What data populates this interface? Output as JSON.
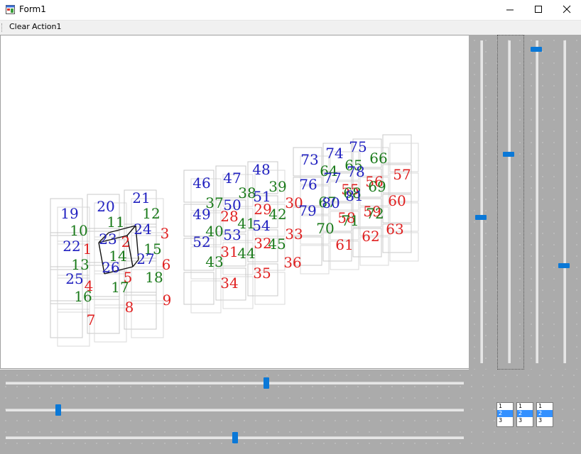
{
  "window": {
    "title": "Form1",
    "icon": "app-window-icon",
    "controls": {
      "minimize": "minimize-icon",
      "maximize": "maximize-icon",
      "close": "close-icon"
    }
  },
  "menu": {
    "items": [
      {
        "label": "Clear"
      },
      {
        "label": "Action1"
      }
    ]
  },
  "colors": {
    "red": "#e02020",
    "green": "#1a7a1a",
    "blue": "#2020c0",
    "accent": "#0a78d7",
    "panel": "#ababab"
  },
  "canvas": {
    "labels": [
      {
        "t": "1",
        "c": "red"
      },
      {
        "t": "2",
        "c": "red"
      },
      {
        "t": "3",
        "c": "red"
      },
      {
        "t": "4",
        "c": "red"
      },
      {
        "t": "5",
        "c": "red"
      },
      {
        "t": "6",
        "c": "red"
      },
      {
        "t": "7",
        "c": "red"
      },
      {
        "t": "8",
        "c": "red"
      },
      {
        "t": "9",
        "c": "red"
      },
      {
        "t": "10",
        "c": "green"
      },
      {
        "t": "11",
        "c": "green"
      },
      {
        "t": "12",
        "c": "green"
      },
      {
        "t": "13",
        "c": "green"
      },
      {
        "t": "14",
        "c": "green"
      },
      {
        "t": "15",
        "c": "green"
      },
      {
        "t": "16",
        "c": "green"
      },
      {
        "t": "17",
        "c": "green"
      },
      {
        "t": "18",
        "c": "green"
      },
      {
        "t": "19",
        "c": "blue"
      },
      {
        "t": "20",
        "c": "blue"
      },
      {
        "t": "21",
        "c": "blue"
      },
      {
        "t": "22",
        "c": "blue"
      },
      {
        "t": "23",
        "c": "blue"
      },
      {
        "t": "24",
        "c": "blue"
      },
      {
        "t": "25",
        "c": "blue"
      },
      {
        "t": "26",
        "c": "blue"
      },
      {
        "t": "27",
        "c": "blue"
      },
      {
        "t": "28",
        "c": "red"
      },
      {
        "t": "29",
        "c": "red"
      },
      {
        "t": "30",
        "c": "red"
      },
      {
        "t": "31",
        "c": "red"
      },
      {
        "t": "32",
        "c": "red"
      },
      {
        "t": "33",
        "c": "red"
      },
      {
        "t": "34",
        "c": "red"
      },
      {
        "t": "35",
        "c": "red"
      },
      {
        "t": "36",
        "c": "red"
      },
      {
        "t": "37",
        "c": "green"
      },
      {
        "t": "38",
        "c": "green"
      },
      {
        "t": "39",
        "c": "green"
      },
      {
        "t": "40",
        "c": "green"
      },
      {
        "t": "41",
        "c": "green"
      },
      {
        "t": "42",
        "c": "green"
      },
      {
        "t": "43",
        "c": "green"
      },
      {
        "t": "44",
        "c": "green"
      },
      {
        "t": "45",
        "c": "green"
      },
      {
        "t": "46",
        "c": "blue"
      },
      {
        "t": "47",
        "c": "blue"
      },
      {
        "t": "48",
        "c": "blue"
      },
      {
        "t": "49",
        "c": "blue"
      },
      {
        "t": "50",
        "c": "blue"
      },
      {
        "t": "51",
        "c": "blue"
      },
      {
        "t": "52",
        "c": "blue"
      },
      {
        "t": "53",
        "c": "blue"
      },
      {
        "t": "54",
        "c": "blue"
      },
      {
        "t": "55",
        "c": "red"
      },
      {
        "t": "56",
        "c": "red"
      },
      {
        "t": "57",
        "c": "red"
      },
      {
        "t": "58",
        "c": "red"
      },
      {
        "t": "59",
        "c": "red"
      },
      {
        "t": "60",
        "c": "red"
      },
      {
        "t": "61",
        "c": "red"
      },
      {
        "t": "62",
        "c": "red"
      },
      {
        "t": "63",
        "c": "red"
      },
      {
        "t": "64",
        "c": "green"
      },
      {
        "t": "65",
        "c": "green"
      },
      {
        "t": "66",
        "c": "green"
      },
      {
        "t": "67",
        "c": "green"
      },
      {
        "t": "68",
        "c": "green"
      },
      {
        "t": "69",
        "c": "green"
      },
      {
        "t": "70",
        "c": "green"
      },
      {
        "t": "71",
        "c": "green"
      },
      {
        "t": "72",
        "c": "green"
      },
      {
        "t": "73",
        "c": "blue"
      },
      {
        "t": "74",
        "c": "blue"
      },
      {
        "t": "75",
        "c": "blue"
      },
      {
        "t": "76",
        "c": "blue"
      },
      {
        "t": "77",
        "c": "blue"
      },
      {
        "t": "78",
        "c": "blue"
      },
      {
        "t": "79",
        "c": "blue"
      },
      {
        "t": "80",
        "c": "blue"
      },
      {
        "t": "81",
        "c": "blue"
      }
    ]
  },
  "sliders": {
    "vertical": [
      {
        "value": 0.55
      },
      {
        "value": 0.35
      },
      {
        "value": 0.02
      },
      {
        "value": 0.7
      }
    ],
    "horizontal": [
      {
        "value": 0.57
      },
      {
        "value": 0.11
      },
      {
        "value": 0.5
      }
    ]
  },
  "listboxes": [
    {
      "items": [
        "1",
        "2",
        "3"
      ],
      "selected": 1
    },
    {
      "items": [
        "1",
        "2",
        "3"
      ],
      "selected": 1
    },
    {
      "items": [
        "1",
        "2",
        "3"
      ],
      "selected": 1
    }
  ]
}
